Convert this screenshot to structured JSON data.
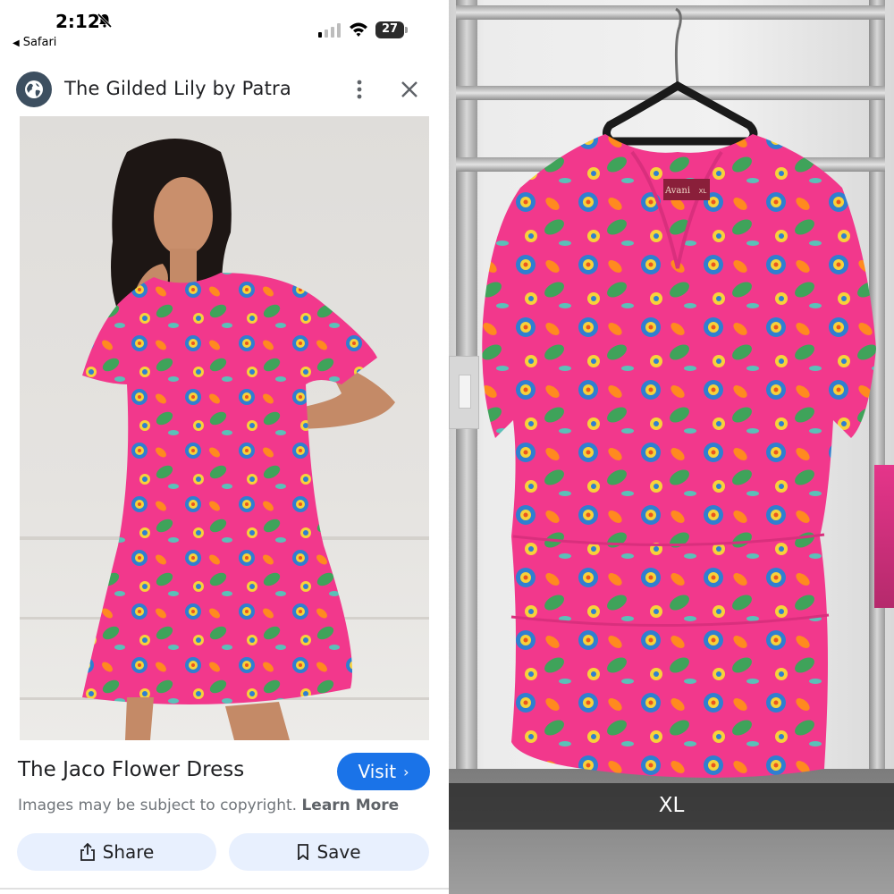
{
  "status_bar": {
    "time": "2:12",
    "back_app": "Safari",
    "battery_level": "27"
  },
  "header": {
    "site_name": "The Gilded Lily by Patra"
  },
  "result": {
    "title": "The Jaco Flower Dress",
    "visit_label": "Visit",
    "visit_chevron": "›",
    "copyright_text": "Images may be subject to copyright.",
    "learn_more": "Learn More",
    "share_label": "Share",
    "save_label": "Save"
  },
  "right_photo": {
    "size_caption": "XL",
    "dress_tag_brand": "Avani",
    "dress_tag_size": "XL"
  },
  "colors": {
    "accent_blue": "#1a73e8",
    "chip_bg": "#e8f0fe",
    "dress_pink": "#f2388c"
  },
  "icons": {
    "globe": "globe-icon",
    "more": "more-vert-icon",
    "close": "close-icon",
    "share": "share-icon",
    "save": "bookmark-icon",
    "bell_slash": "bell-slash-icon",
    "signal": "signal-icon",
    "wifi": "wifi-icon",
    "battery": "battery-icon"
  }
}
